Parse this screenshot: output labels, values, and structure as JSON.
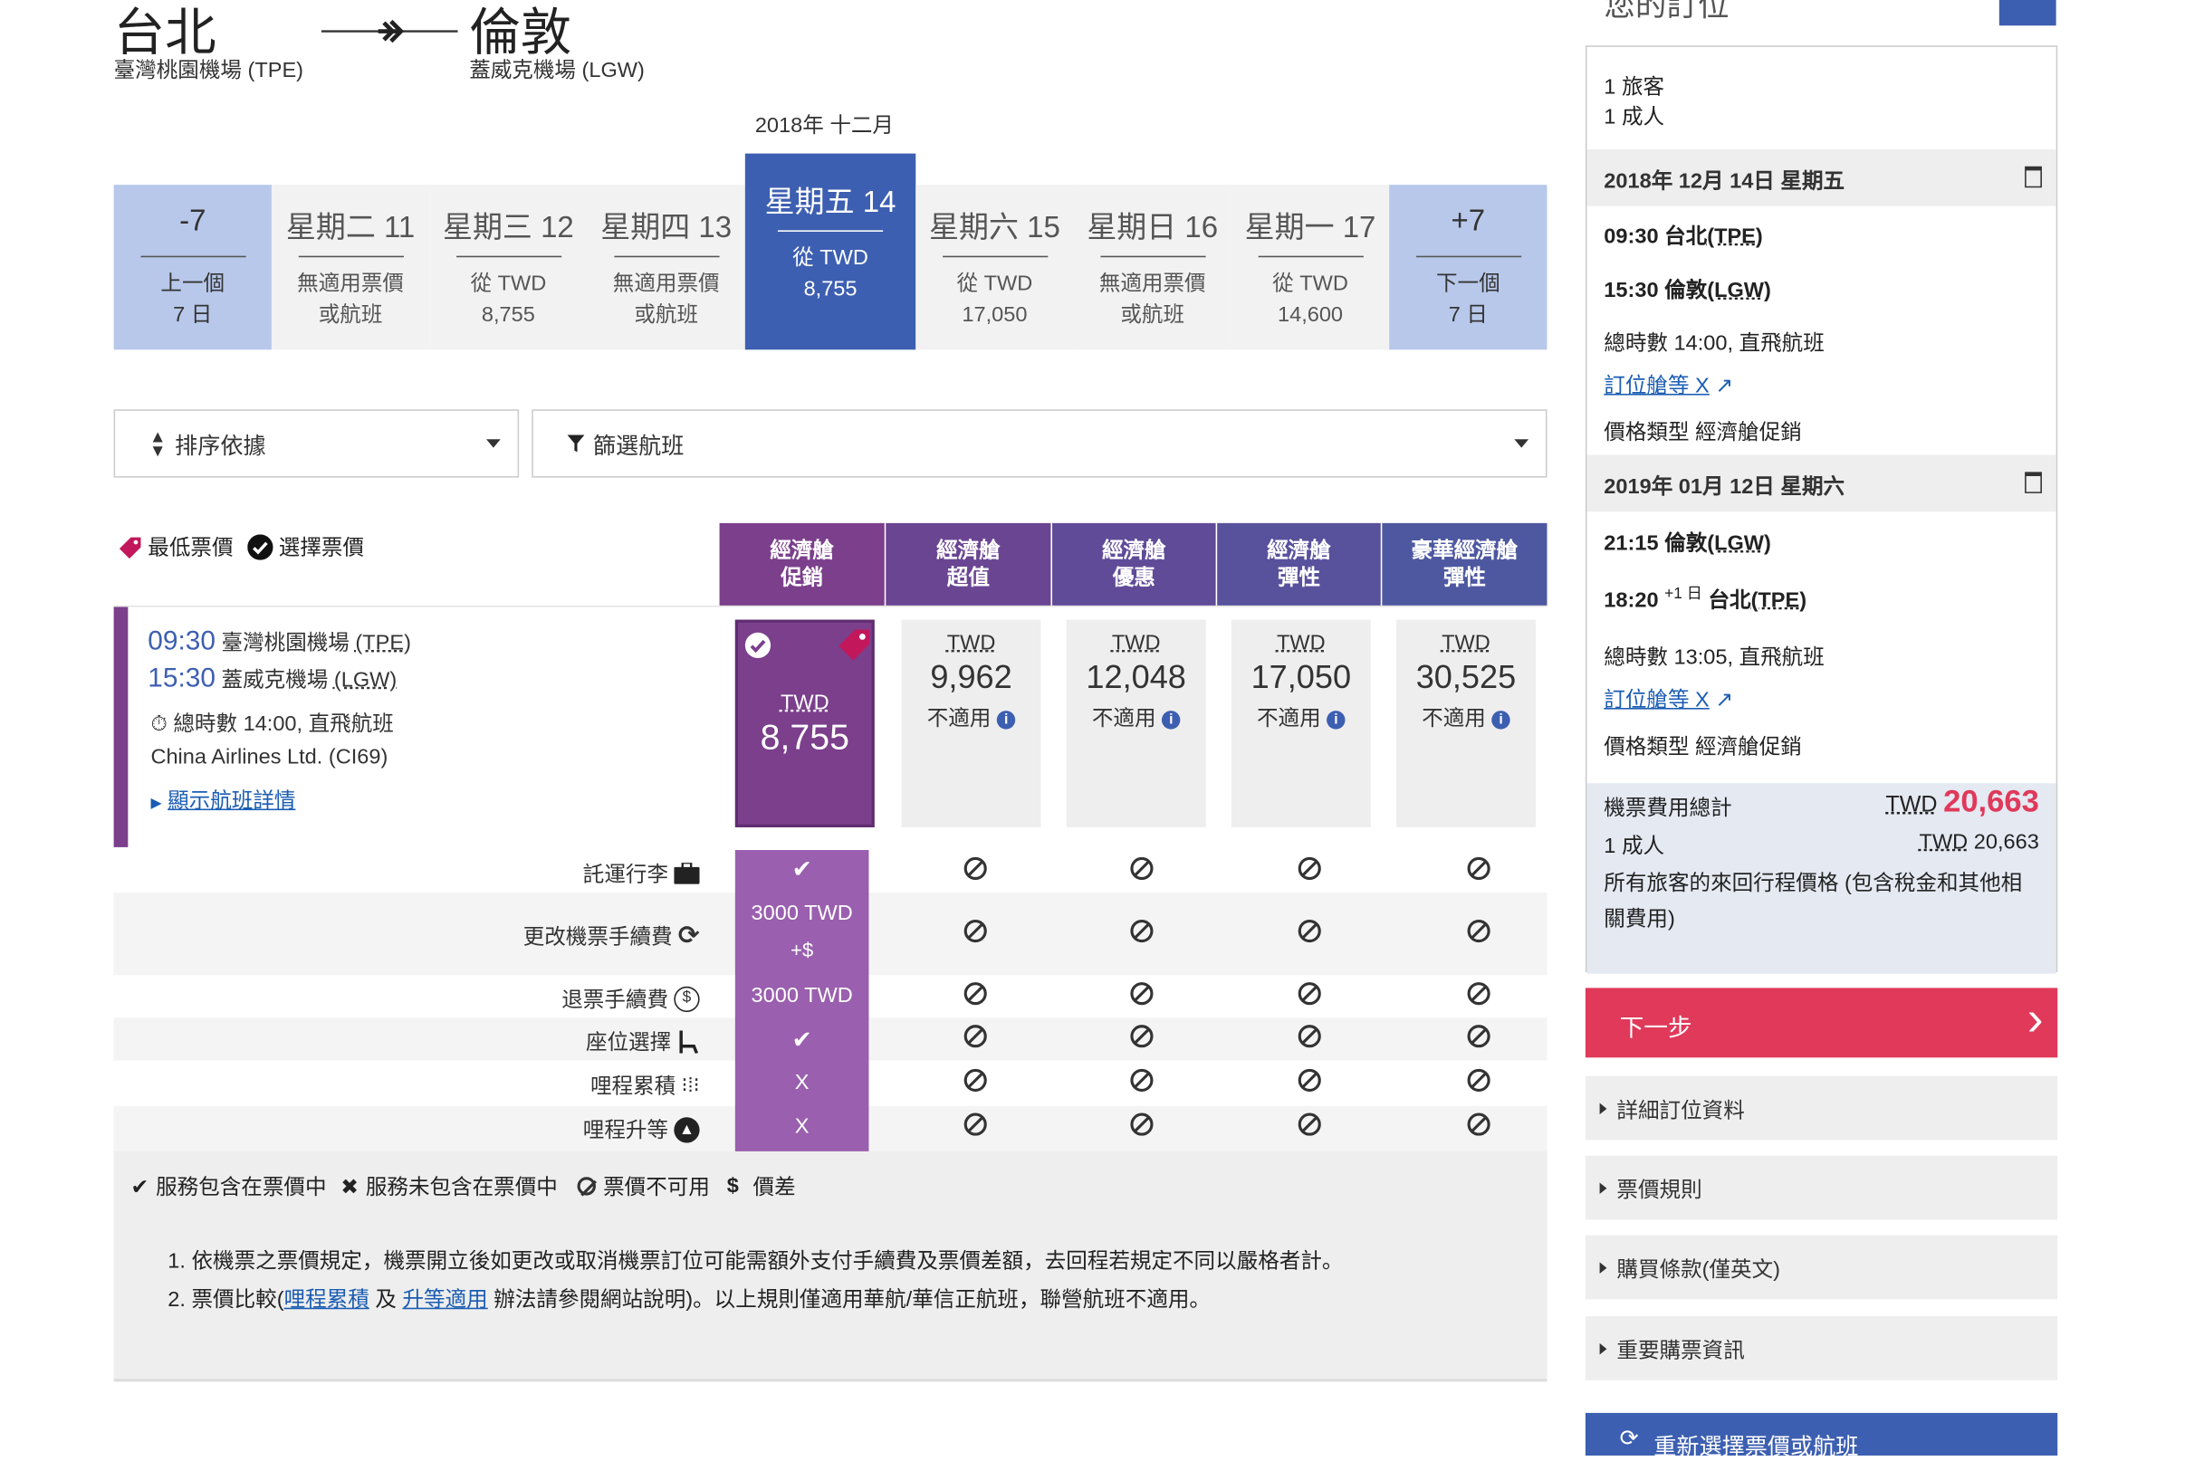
{
  "route": {
    "origin_city": "台北",
    "origin_airport": "臺灣桃園機場 (TPE)",
    "dest_city": "倫敦",
    "dest_airport": "蓋威克機場 (LGW)"
  },
  "month_label": "2018年 十二月",
  "dates": [
    {
      "top": "-7",
      "line1": "上一個",
      "line2": "7 日"
    },
    {
      "top": "星期二 11",
      "line1": "無適用票價",
      "line2": "或航班"
    },
    {
      "top": "星期三 12",
      "line1": "從 TWD",
      "line2": "8,755"
    },
    {
      "top": "星期四 13",
      "line1": "無適用票價",
      "line2": "或航班"
    },
    {
      "top": "星期五 14",
      "line1": "從 TWD",
      "line2": "8,755"
    },
    {
      "top": "星期六 15",
      "line1": "從 TWD",
      "line2": "17,050"
    },
    {
      "top": "星期日 16",
      "line1": "無適用票價",
      "line2": "或航班"
    },
    {
      "top": "星期一 17",
      "line1": "從 TWD",
      "line2": "14,600"
    },
    {
      "top": "+7",
      "line1": "下一個",
      "line2": "7 日"
    }
  ],
  "sort_label": "排序依據",
  "filter_label": "篩選航班",
  "legend": {
    "lowest": "最低票價",
    "selected": "選擇票價"
  },
  "fare_headers": [
    {
      "l1": "經濟艙",
      "l2": "促銷",
      "color": "#7b3f8c"
    },
    {
      "l1": "經濟艙",
      "l2": "超值",
      "color": "#6a4592"
    },
    {
      "l1": "經濟艙",
      "l2": "優惠",
      "color": "#5f4b98"
    },
    {
      "l1": "經濟艙",
      "l2": "彈性",
      "color": "#58519c"
    },
    {
      "l1": "豪華經濟艙",
      "l2": "彈性",
      "color": "#4e58a0"
    }
  ],
  "flight": {
    "dep_time": "09:30",
    "dep_airport": "臺灣桃園機場",
    "dep_code": "(TPE)",
    "arr_time": "15:30",
    "arr_airport": "蓋威克機場",
    "arr_code": "(LGW)",
    "duration": "總時數 14:00, 直飛航班",
    "carrier": "China Airlines Ltd. (CI69)",
    "details_link": "顯示航班詳情"
  },
  "fares": [
    {
      "currency": "TWD",
      "amount": "8,755",
      "status": ""
    },
    {
      "currency": "TWD",
      "amount": "9,962",
      "status": "不適用"
    },
    {
      "currency": "TWD",
      "amount": "12,048",
      "status": "不適用"
    },
    {
      "currency": "TWD",
      "amount": "17,050",
      "status": "不適用"
    },
    {
      "currency": "TWD",
      "amount": "30,525",
      "status": "不適用"
    }
  ],
  "services": [
    {
      "label": "託運行李",
      "value": "✔"
    },
    {
      "label": "更改機票手續費",
      "value": "3000 TWD",
      "value2": "+$"
    },
    {
      "label": "退票手續費",
      "value": "3000 TWD"
    },
    {
      "label": "座位選擇",
      "value": "✔"
    },
    {
      "label": "哩程累積",
      "value": "X"
    },
    {
      "label": "哩程升等",
      "value": "X"
    }
  ],
  "service_key": {
    "included": "服務包含在票價中",
    "excluded": "服務未包含在票價中",
    "unavailable": "票價不可用",
    "diff_symbol": "$",
    "diff": "價差"
  },
  "notes": {
    "n1": "1. 依機票之票價規定，機票開立後如更改或取消機票訂位可能需額外支付手續費及票價差額，去回程若規定不同以嚴格者計。",
    "n2_a": "2. 票價比較(",
    "n2_link1": "哩程累積",
    "n2_b": "及",
    "n2_link2": "升等適用",
    "n2_c": "辦法請參閱網站說明)。以上規則僅適用華航/華信正航班，聯營航班不適用。"
  },
  "panel": {
    "title": "您的訂位",
    "travelers": "1 旅客",
    "adults": "1 成人",
    "out_date": "2018年 12月 14日 星期五",
    "out_dep": "09:30 台北",
    "out_dep_code": "(TPE)",
    "out_arr": "15:30 倫敦",
    "out_arr_code": "(LGW)",
    "out_duration": "總時數 14:00, 直飛航班",
    "out_class": "訂位艙等 X",
    "out_fare_type": "價格類型 經濟艙促銷",
    "ret_date": "2019年 01月 12日 星期六",
    "ret_dep": "21:15 倫敦",
    "ret_dep_code": "(LGW)",
    "ret_arr": "18:20",
    "ret_arr_sup": "+1 日",
    "ret_arr_city": "台北",
    "ret_arr_code": "(TPE)",
    "ret_duration": "總時數 13:05, 直飛航班",
    "ret_class": "訂位艙等 X",
    "ret_fare_type": "價格類型 經濟艙促銷",
    "total_label": "機票費用總計",
    "total_cur": "TWD",
    "total_amount": "20,663",
    "adult_label": "1 成人",
    "adult_cur": "TWD",
    "adult_amount": "20,663",
    "total_note1": "所有旅客的來回行程價格 (包含稅金和其他相",
    "total_note2": "關費用)"
  },
  "next_label": "下一步",
  "accordion": [
    "詳細訂位資料",
    "票價規則",
    "購買條款(僅英文)",
    "重要購票資訊"
  ],
  "reselect_label": "重新選擇票價或航班"
}
